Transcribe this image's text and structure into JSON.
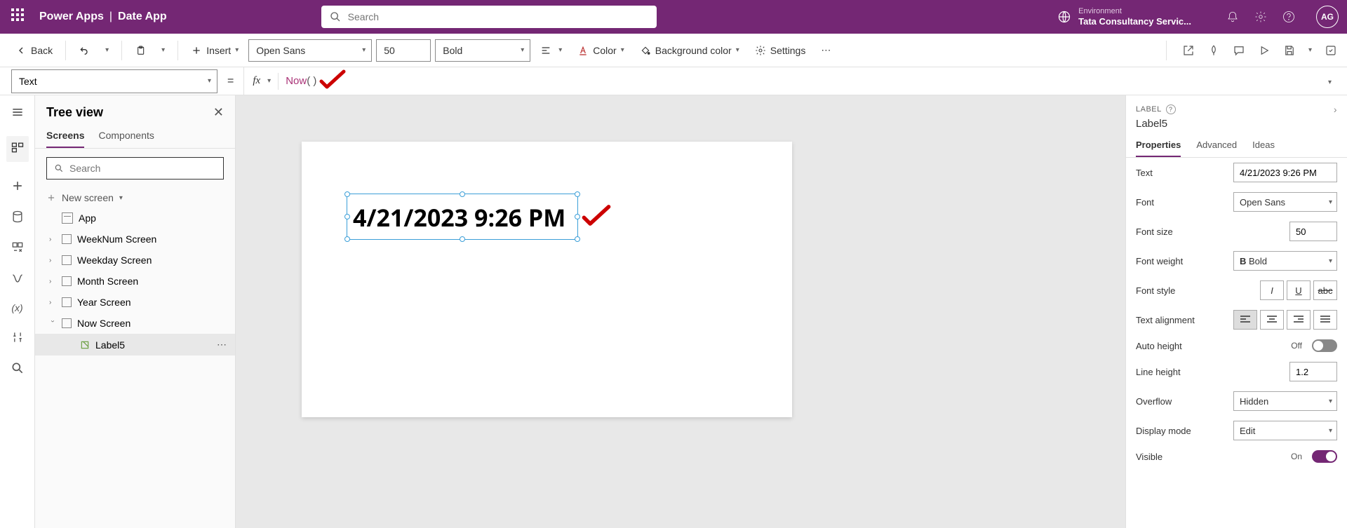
{
  "header": {
    "brand": "Power Apps",
    "app_name": "Date App",
    "search_placeholder": "Search",
    "env_label": "Environment",
    "env_name": "Tata Consultancy Servic...",
    "avatar_initials": "AG"
  },
  "toolbar": {
    "back": "Back",
    "insert": "Insert",
    "font": "Open Sans",
    "font_size": "50",
    "font_weight": "Bold",
    "color": "Color",
    "bg_color": "Background color",
    "settings": "Settings"
  },
  "formula": {
    "property": "Text",
    "fn_name": "Now",
    "fn_parens": "( )"
  },
  "tree": {
    "title": "Tree view",
    "tab_screens": "Screens",
    "tab_components": "Components",
    "search_placeholder": "Search",
    "new_screen": "New screen",
    "app": "App",
    "items": [
      "WeekNum Screen",
      "Weekday Screen",
      "Month Screen",
      "Year Screen",
      "Now Screen"
    ],
    "selected_child": "Label5"
  },
  "canvas": {
    "label_text": "4/21/2023 9:26 PM"
  },
  "right_panel": {
    "type_label": "LABEL",
    "control_name": "Label5",
    "tab_properties": "Properties",
    "tab_advanced": "Advanced",
    "tab_ideas": "Ideas",
    "rows": {
      "text_label": "Text",
      "text_value": "4/21/2023 9:26 PM",
      "font_label": "Font",
      "font_value": "Open Sans",
      "font_size_label": "Font size",
      "font_size_value": "50",
      "font_weight_label": "Font weight",
      "font_weight_value": "Bold",
      "font_style_label": "Font style",
      "text_align_label": "Text alignment",
      "auto_height_label": "Auto height",
      "auto_height_value": "Off",
      "line_height_label": "Line height",
      "line_height_value": "1.2",
      "overflow_label": "Overflow",
      "overflow_value": "Hidden",
      "display_mode_label": "Display mode",
      "display_mode_value": "Edit",
      "visible_label": "Visible",
      "visible_value": "On"
    }
  }
}
